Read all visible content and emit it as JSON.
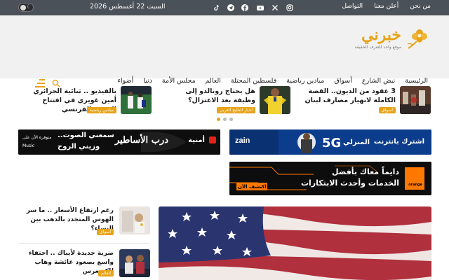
{
  "topbar": {
    "links": [
      "من نحن",
      "أعلن معنا",
      "التواصل"
    ],
    "date": "السبت 22 أغسطس 2026",
    "socials": [
      "instagram-icon",
      "x-icon",
      "youtube-icon",
      "facebook-icon",
      "telegram-icon",
      "tiktok-icon"
    ]
  },
  "logo": {
    "name": "خبرني",
    "tagline": "موقع واحد للتعرف للحقيقة"
  },
  "nav": {
    "items": [
      "الرئيسية",
      "نبض الشارع",
      "أسواق",
      "ميادين رياضية",
      "فلسطين المحتلة",
      "العالم",
      "مجلس الأمة",
      "دنيا",
      "أضواء"
    ]
  },
  "carousel": {
    "slides": [
      {
        "title": "3 عقود من الديون.. القصة الكاملة لانهيار مصارف لبنان",
        "badge": "أسواق"
      },
      {
        "title": "هل يحتاج رونالدو إلى وظيفة بعد الاعتزال؟",
        "badge": "أخبار الخليج العربي"
      },
      {
        "title": "بالفيديو .. ثنائية الجزائري أمين غويري في افتتاح الدوري الفرنسي",
        "badge": "ميادين رياضية"
      }
    ]
  },
  "ads": {
    "zain": {
      "text": "اشترك بانترنت",
      "fiveg": "5G",
      "home": "المنزلي",
      "brand": "zain"
    },
    "orange": {
      "line1": "دايماً معاك بأفضل",
      "line2": "الخدمات وأحدث الابتكارات",
      "cta": "اكتشف الآن",
      "brand": "orange"
    },
    "umniah": {
      "brand": "أمنية",
      "title": "درب الأساطير",
      "line1": "سمعني الصوت..",
      "line2": "وزيني الروح",
      "avail": "متوفرة الآن على",
      "music": "Music"
    }
  },
  "side_news": [
    {
      "title": "رغم ارتفاع الأسعار .. ما سر الهوس المتجدد بالذهب بين النساء؟",
      "badge": "أسواق"
    },
    {
      "title": "ضربة جديدة لأيباك .. احتفاء واسع بصعود عائشة وهاب للكونغرس",
      "badge": "العالم"
    }
  ],
  "colors": {
    "accent": "#e8a317",
    "topbar": "#4b5158",
    "header": "#f1f1f1"
  }
}
